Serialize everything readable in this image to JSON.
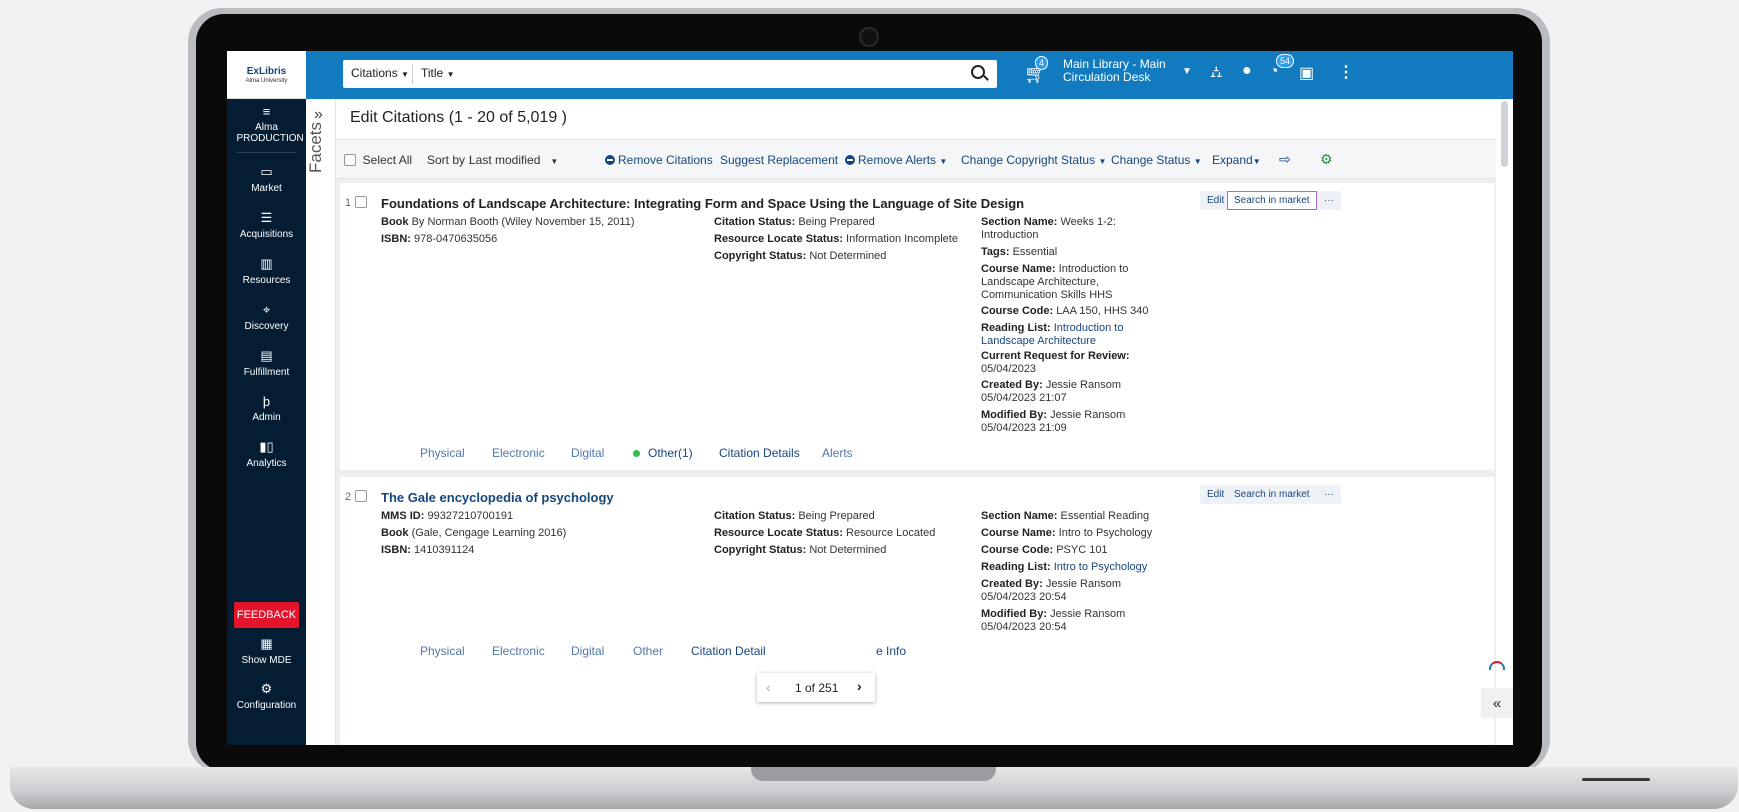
{
  "app": {
    "logo_main": "ExLibris",
    "logo_sub": "Alma University",
    "env_label": "Alma PRODUCTION"
  },
  "nav": {
    "items": [
      {
        "label": "Market",
        "icon": "market-icon"
      },
      {
        "label": "Acquisitions",
        "icon": "acquisitions-icon"
      },
      {
        "label": "Resources",
        "icon": "resources-icon"
      },
      {
        "label": "Discovery",
        "icon": "telescope-icon"
      },
      {
        "label": "Fulfillment",
        "icon": "fulfillment-icon"
      },
      {
        "label": "Admin",
        "icon": "wrench-icon"
      },
      {
        "label": "Analytics",
        "icon": "chart-icon"
      }
    ],
    "feedback": "FEEDBACK",
    "show_mde": "Show MDE",
    "configuration": "Configuration"
  },
  "search": {
    "scope": "Citations",
    "field": "Title",
    "value": ""
  },
  "topbar": {
    "cart_count": "4",
    "circ_desk_line1": "Main Library - Main",
    "circ_desk_line2": "Circulation Desk",
    "notif_count": "54",
    "accent": "#127bc0"
  },
  "facets": {
    "label": "Facets",
    "expand": "»"
  },
  "page": {
    "title": "Edit Citations (1 - 20 of 5,019 )"
  },
  "actions": {
    "select_all": "Select All",
    "sort_by": "Sort by :",
    "sort_value": "Last modified",
    "remove_citations": "Remove Citations",
    "suggest_replacement": "Suggest Replacement",
    "remove_alerts": "Remove Alerts",
    "change_copyright": "Change Copyright Status",
    "change_status": "Change Status",
    "expand": "Expand"
  },
  "records": [
    {
      "num": "1",
      "title": "Foundations of Landscape Architecture: Integrating Form and Space Using the Language of Site Design",
      "book_label": "Book",
      "book_value": "By Norman Booth (Wiley November 15, 2011)",
      "isbn_label": "ISBN:",
      "isbn_value": "978-0470635056",
      "citation_status_label": "Citation Status:",
      "citation_status": "Being Prepared",
      "resource_locate_label": "Resource Locate Status:",
      "resource_locate": "Information Incomplete",
      "copyright_label": "Copyright Status:",
      "copyright": "Not Determined",
      "section_label": "Section Name:",
      "section_line1": "Weeks 1-2:",
      "section_line2": "Introduction",
      "tags_label": "Tags:",
      "tags": "Essential",
      "course_name_label": "Course Name:",
      "course_name_line1": "Introduction to",
      "course_name_line2": "Landscape Architecture,",
      "course_name_line3": "Communication Skills HHS",
      "course_code_label": "Course Code:",
      "course_code": "LAA 150, HHS 340",
      "reading_list_label": "Reading List:",
      "reading_list_line1": "Introduction to",
      "reading_list_line2": "Landscape Architecture",
      "review_label": "Current Request for Review:",
      "review_date": "05/04/2023",
      "created_label": "Created By:",
      "created_by": "Jessie Ransom",
      "created_date": "05/04/2023 21:07",
      "modified_label": "Modified By:",
      "modified_by": "Jessie Ransom",
      "modified_date": "05/04/2023 21:09",
      "tabs": [
        "Physical",
        "Electronic",
        "Digital",
        "Other(1)",
        "Citation Details",
        "Alerts"
      ],
      "edit": "Edit",
      "search_market": "Search in market",
      "more": "···"
    },
    {
      "num": "2",
      "title": "The Gale encyclopedia of psychology",
      "mms_label": "MMS ID:",
      "mms_value": "99327210700191",
      "book_label": "Book",
      "book_value": "(Gale, Cengage Learning 2016)",
      "isbn_label": "ISBN:",
      "isbn_value": "1410391124",
      "citation_status_label": "Citation Status:",
      "citation_status": "Being Prepared",
      "resource_locate_label": "Resource Locate Status:",
      "resource_locate": "Resource Located",
      "copyright_label": "Copyright Status:",
      "copyright": "Not Determined",
      "section_label": "Section Name:",
      "section": "Essential Reading",
      "course_name_label": "Course Name:",
      "course_name": "Intro to Psychology",
      "course_code_label": "Course Code:",
      "course_code": "PSYC 101",
      "reading_list_label": "Reading List:",
      "reading_list": "Intro to Psychology",
      "created_label": "Created By:",
      "created_by": "Jessie Ransom",
      "created_date": "05/04/2023 20:54",
      "modified_label": "Modified By:",
      "modified_by": "Jessie Ransom",
      "modified_date": "05/04/2023 20:54",
      "tabs": [
        "Physical",
        "Electronic",
        "Digital",
        "Other",
        "Citation Detail",
        "e Info"
      ],
      "edit": "Edit",
      "search_market": "Search in market",
      "more": "···"
    }
  ],
  "pager": {
    "prev": "‹",
    "text": "1 of 251",
    "next": "›"
  },
  "collapse": "«"
}
